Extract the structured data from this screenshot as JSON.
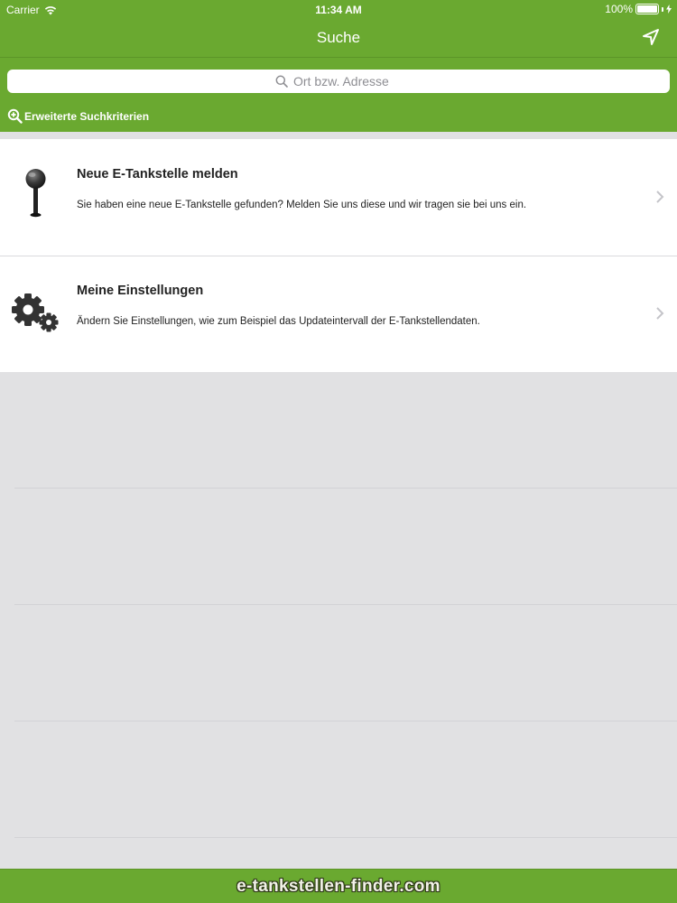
{
  "status_bar": {
    "carrier": "Carrier",
    "time": "11:34 AM",
    "battery": "100%"
  },
  "nav": {
    "title": "Suche"
  },
  "search": {
    "placeholder": "Ort bzw. Adresse",
    "value": ""
  },
  "advanced_search": {
    "label": "Erweiterte Suchkriterien"
  },
  "menu": {
    "items": [
      {
        "title": "Neue E-Tankstelle melden",
        "description": "Sie haben eine neue E-Tankstelle gefunden? Melden Sie uns diese und wir tragen sie bei uns ein.",
        "icon": "map-pin-icon"
      },
      {
        "title": "Meine Einstellungen",
        "description": "Ändern Sie Einstellungen, wie zum Beispiel das Updateintervall der E-Tankstellendaten.",
        "icon": "gears-icon"
      }
    ]
  },
  "footer": {
    "brand": "e-tankstellen-finder.com"
  },
  "colors": {
    "brand_green": "#6aa930",
    "background": "#e1e1e3"
  }
}
